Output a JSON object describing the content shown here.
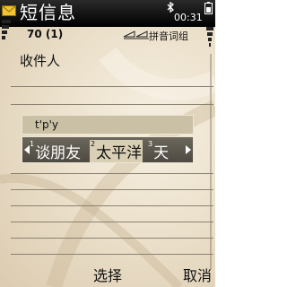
{
  "status": {
    "app_title": "短信息",
    "time": "00:31",
    "icons": [
      "mail-envelope-icon",
      "bluetooth-icon",
      "battery-icon",
      "signal-icon"
    ]
  },
  "editor": {
    "char_count": "70 (1)",
    "input_mode": "拼音词组",
    "recipient_label": "收件人"
  },
  "ime": {
    "pinyin": "t'p'y",
    "candidates": [
      {
        "num": "1",
        "text": "谈朋友"
      },
      {
        "num": "2",
        "text": "太平洋"
      },
      {
        "num": "3",
        "text": "天"
      }
    ],
    "selected_index": 1
  },
  "softkeys": {
    "left": "选择",
    "right": "取消"
  },
  "colors": {
    "status_bar": "#000000",
    "candidate_bg": "#5a564d",
    "highlight": "#d9cfb4"
  }
}
